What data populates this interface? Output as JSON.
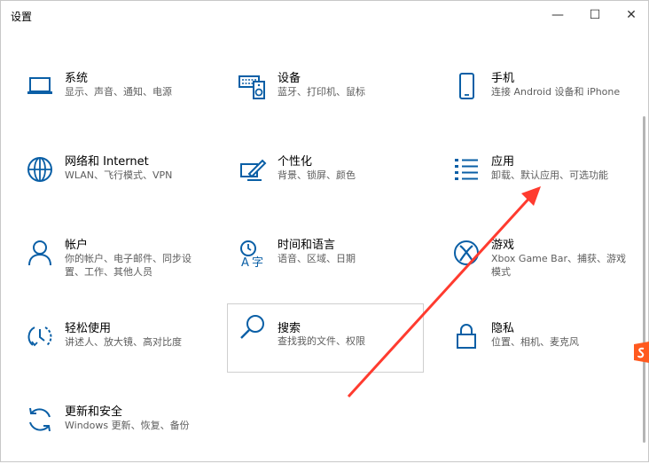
{
  "window": {
    "title": "设置",
    "minimize_glyph": "—",
    "maximize_glyph": "☐",
    "close_glyph": "✕"
  },
  "tiles": [
    {
      "id": "system",
      "title": "系统",
      "desc": "显示、声音、通知、电源",
      "icon": "laptop-icon"
    },
    {
      "id": "devices",
      "title": "设备",
      "desc": "蓝牙、打印机、鼠标",
      "icon": "keyboard-speaker-icon"
    },
    {
      "id": "phone",
      "title": "手机",
      "desc": "连接 Android 设备和 iPhone",
      "icon": "phone-icon"
    },
    {
      "id": "network",
      "title": "网络和 Internet",
      "desc": "WLAN、飞行模式、VPN",
      "icon": "globe-icon"
    },
    {
      "id": "personalization",
      "title": "个性化",
      "desc": "背景、锁屏、颜色",
      "icon": "pen-screen-icon"
    },
    {
      "id": "apps",
      "title": "应用",
      "desc": "卸载、默认应用、可选功能",
      "icon": "apps-list-icon"
    },
    {
      "id": "accounts",
      "title": "帐户",
      "desc": "你的帐户、电子邮件、同步设置、工作、其他人员",
      "icon": "person-icon"
    },
    {
      "id": "time_language",
      "title": "时间和语言",
      "desc": "语音、区域、日期",
      "icon": "time-language-icon"
    },
    {
      "id": "gaming",
      "title": "游戏",
      "desc": "Xbox Game Bar、捕获、游戏模式",
      "icon": "xbox-icon"
    },
    {
      "id": "ease_of_access",
      "title": "轻松使用",
      "desc": "讲述人、放大镜、高对比度",
      "icon": "ease-of-access-icon"
    },
    {
      "id": "search",
      "title": "搜索",
      "desc": "查找我的文件、权限",
      "icon": "search-icon"
    },
    {
      "id": "privacy",
      "title": "隐私",
      "desc": "位置、相机、麦克风",
      "icon": "lock-icon"
    },
    {
      "id": "update_security",
      "title": "更新和安全",
      "desc": "Windows 更新、恢复、备份",
      "icon": "sync-icon"
    }
  ],
  "colors": {
    "icon_blue": "#0a5fa6",
    "annotation_arrow": "#ff3b2f",
    "hover_border": "#cfcfcf"
  }
}
